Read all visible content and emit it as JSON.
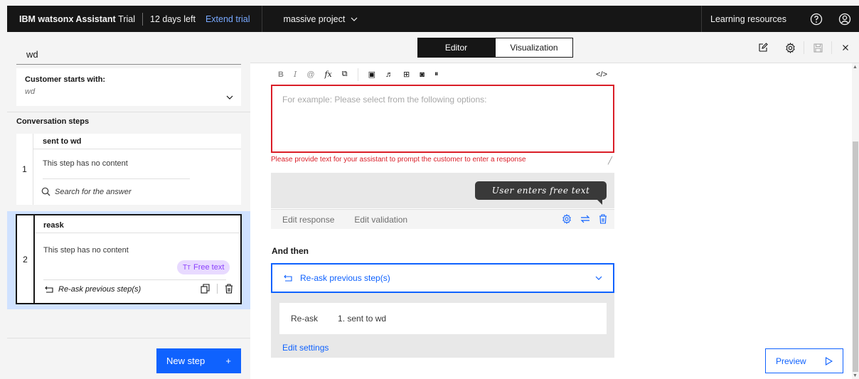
{
  "topbar": {
    "brand_bold": "IBM watsonx Assistant",
    "brand_plan": "Trial",
    "days_left": "12 days left",
    "extend_trial": "Extend trial",
    "project": "massive project",
    "learning_resources": "Learning resources"
  },
  "left": {
    "search_value": "wd",
    "customer_starts_label": "Customer starts with:",
    "customer_starts_value": "wd",
    "conversation_steps_label": "Conversation steps",
    "steps": [
      {
        "number": "1",
        "title": "sent to wd",
        "content": "This step has no content",
        "action": "Search for the answer"
      },
      {
        "number": "2",
        "title": "reask",
        "content": "This step has no content",
        "tag": "Free text",
        "action": "Re-ask previous step(s)"
      }
    ],
    "new_step_label": "New step",
    "new_step_plus": "+"
  },
  "header": {
    "editor_tab": "Editor",
    "visualization_tab": "Visualization"
  },
  "editor": {
    "toolbar": [
      "B",
      "I",
      "@",
      "fx",
      "⧉",
      "▣",
      "♬",
      "⊞",
      "◙",
      "⏸"
    ],
    "code_toggle": "</>",
    "placeholder": "For example: Please select from the following options:",
    "error": "Please provide text for your assistant to prompt the customer to enter a response",
    "bubble": "User enters free text",
    "edit_response": "Edit response",
    "edit_validation": "Edit validation",
    "and_then_label": "And then",
    "and_then_value": "Re-ask previous step(s)",
    "reask_label": "Re-ask",
    "reask_value": "1. sent to wd",
    "edit_settings": "Edit settings"
  },
  "preview_label": "Preview",
  "colors": {
    "topbar_bg": "#161616",
    "accent_blue": "#0f62fe",
    "error_red": "#da1e28",
    "selected_step_bg": "#d0e2ff",
    "tag_bg": "#e8daff",
    "tag_fg": "#8a3ffc"
  }
}
